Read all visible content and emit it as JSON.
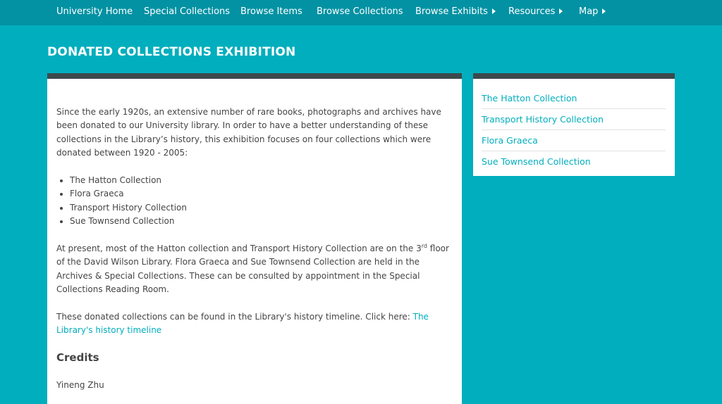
{
  "nav": {
    "items": [
      {
        "label": "University Home",
        "dropdown": false
      },
      {
        "label": "Special Collections",
        "dropdown": false
      },
      {
        "label": "Browse Items",
        "dropdown": false
      },
      {
        "label": "Browse Collections",
        "dropdown": false
      },
      {
        "label": "Browse Exhibits",
        "dropdown": true
      },
      {
        "label": "Resources",
        "dropdown": true
      },
      {
        "label": "Map",
        "dropdown": true
      }
    ]
  },
  "page": {
    "title": "DONATED COLLECTIONS EXHIBITION"
  },
  "main": {
    "intro": "Since the early 1920s, an extensive number of rare books, photographs and archives have been donated to our University library. In order to have a better understanding of these collections in the Library’s history, this exhibition focuses on four collections which were donated between 1920 - 2005:",
    "list": [
      "The Hatton Collection",
      "Flora Graeca",
      "Transport History Collection",
      "Sue Townsend Collection"
    ],
    "para2_before": "At present, most of the Hatton collection and Transport History Collection are on the 3",
    "para2_sup": "rd",
    "para2_after": " floor of the David Wilson Library. Flora Graeca and Sue Townsend Collection are held in the Archives & Special Collections. These can be consulted by appointment in the Special Collections Reading Room.",
    "para3_text": "These donated collections can be found in the Library's history timeline. Click here: ",
    "para3_link": "The Library's history timeline",
    "credits_heading": "Credits",
    "credits_name": "Yineng Zhu"
  },
  "sidebar": {
    "links": [
      "The Hatton Collection",
      "Transport History Collection",
      "Flora Graeca",
      "Sue Townsend Collection"
    ]
  },
  "colors": {
    "background": "#00aebd",
    "nav_bar": "#0392a3",
    "panel_border": "#3c4a4c",
    "link": "#00aebd",
    "text": "#444444"
  }
}
